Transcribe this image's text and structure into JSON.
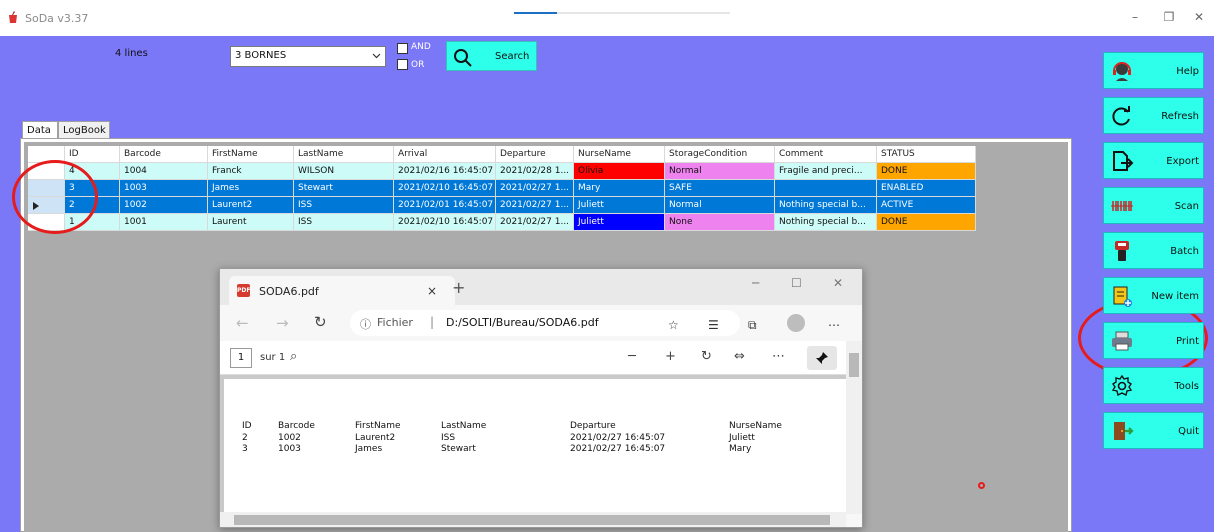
{
  "window": {
    "title": "SoDa v3.37",
    "controls": [
      "–",
      "❐",
      "✕"
    ]
  },
  "colors": {
    "background": "#7b78f7",
    "button": "#2dffea",
    "selection": "#0078d7",
    "row_light": "#cdfcf8",
    "done": "#ffa500",
    "nurse_red": "#ff0000",
    "nurse_blue": "#0000ff",
    "storage_pink": "#ee82ee"
  },
  "filters": {
    "lines_count": "4 lines",
    "combo_value": "3 BORNES",
    "and_label": "AND",
    "or_label": "OR",
    "search_label": "Search"
  },
  "tabs": [
    {
      "label": "Data",
      "active": true
    },
    {
      "label": "LogBook",
      "active": false
    }
  ],
  "grid": {
    "columns": [
      "ID",
      "Barcode",
      "FirstName",
      "LastName",
      "Arrival",
      "Departure",
      "NurseName",
      "StorageCondition",
      "Comment",
      "STATUS"
    ],
    "rows": [
      {
        "id": "4",
        "barcode": "1004",
        "first": "Franck",
        "last": "WILSON",
        "arrival": "2021/02/16 16:45:07",
        "departure": "2021/02/28 1...",
        "nurse": "Olivia",
        "storage": "Normal",
        "comment": "Fragile and preci...",
        "status": "DONE"
      },
      {
        "id": "3",
        "barcode": "1003",
        "first": "James",
        "last": "Stewart",
        "arrival": "2021/02/10 16:45:07",
        "departure": "2021/02/27 1...",
        "nurse": "Mary",
        "storage": "SAFE",
        "comment": "",
        "status": "ENABLED"
      },
      {
        "id": "2",
        "barcode": "1002",
        "first": "Laurent2",
        "last": "ISS",
        "arrival": "2021/02/01 16:45:07",
        "departure": "2021/02/27 1...",
        "nurse": "Juliett",
        "storage": "Normal",
        "comment": "Nothing special b...",
        "status": "ACTIVE"
      },
      {
        "id": "1",
        "barcode": "1001",
        "first": "Laurent",
        "last": "ISS",
        "arrival": "2021/02/10 16:45:07",
        "departure": "2021/02/27 1...",
        "nurse": "Juliett",
        "storage": "None",
        "comment": "Nothing special b...",
        "status": "DONE"
      }
    ]
  },
  "sidebar": {
    "buttons": [
      {
        "label": "Help",
        "icon": "headset-icon"
      },
      {
        "label": "Refresh",
        "icon": "refresh-icon"
      },
      {
        "label": "Export",
        "icon": "export-icon"
      },
      {
        "label": "Scan",
        "icon": "barcode-icon"
      },
      {
        "label": "Batch",
        "icon": "scanner-icon"
      },
      {
        "label": "New item",
        "icon": "new-item-icon"
      },
      {
        "label": "Print",
        "icon": "printer-icon"
      },
      {
        "label": "Tools",
        "icon": "gear-icon"
      },
      {
        "label": "Quit",
        "icon": "exit-door-icon"
      }
    ]
  },
  "pdf_viewer": {
    "tab_title": "SODA6.pdf",
    "tab_close": "×",
    "new_tab": "+",
    "url_scheme": "Fichier",
    "url_path": "D:/SOLTI/Bureau/SODA6.pdf",
    "page_number": "1",
    "page_total": "sur 1",
    "report": {
      "headers": [
        "ID",
        "Barcode",
        "FirstName",
        "LastName",
        "Departure",
        "NurseName"
      ],
      "rows": [
        [
          "2",
          "1002",
          "Laurent2",
          "ISS",
          "2021/02/27 16:45:07",
          "Juliett"
        ],
        [
          "3",
          "1003",
          "James",
          "Stewart",
          "2021/02/27 16:45:07",
          "Mary"
        ]
      ]
    }
  }
}
